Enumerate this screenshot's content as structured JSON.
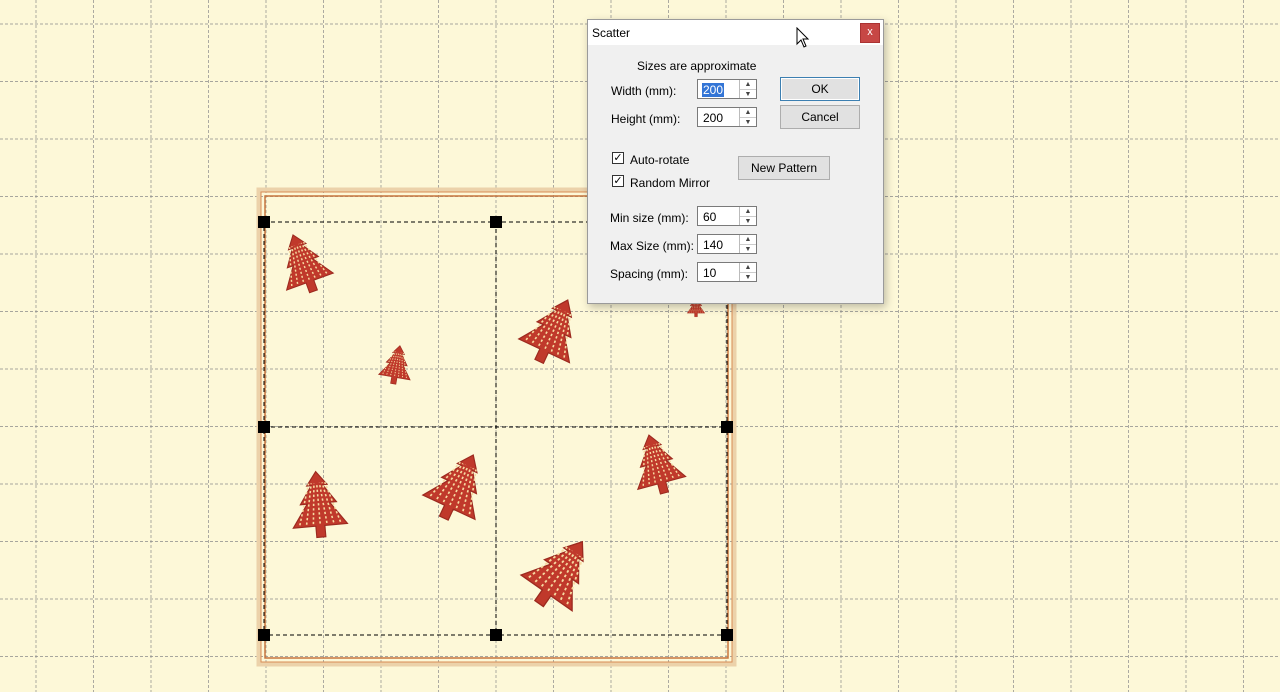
{
  "dialog": {
    "title": "Scatter",
    "close_glyph": "x",
    "note": "Sizes are approximate",
    "width": {
      "label": "Width (mm):",
      "value": "200"
    },
    "height": {
      "label": "Height (mm):",
      "value": "200"
    },
    "ok_label": "OK",
    "cancel_label": "Cancel",
    "auto_rotate": {
      "label": "Auto-rotate",
      "checked": true
    },
    "random_mirror": {
      "label": "Random Mirror",
      "checked": true
    },
    "new_pattern_label": "New Pattern",
    "min_size": {
      "label": "Min size (mm):",
      "value": "60"
    },
    "max_size": {
      "label": "Max Size (mm):",
      "value": "140"
    },
    "spacing": {
      "label": "Spacing (mm):",
      "value": "10"
    }
  },
  "canvas": {
    "background_color": "#fdf8d8",
    "grid_color": "#8a8a8a",
    "hoop_color": "#e8c8a0",
    "tree_color": "#c0392b",
    "tree_count": 9,
    "icons": [
      "christmas-tree-icon",
      "selection-handle",
      "mouse-pointer-icon"
    ]
  }
}
